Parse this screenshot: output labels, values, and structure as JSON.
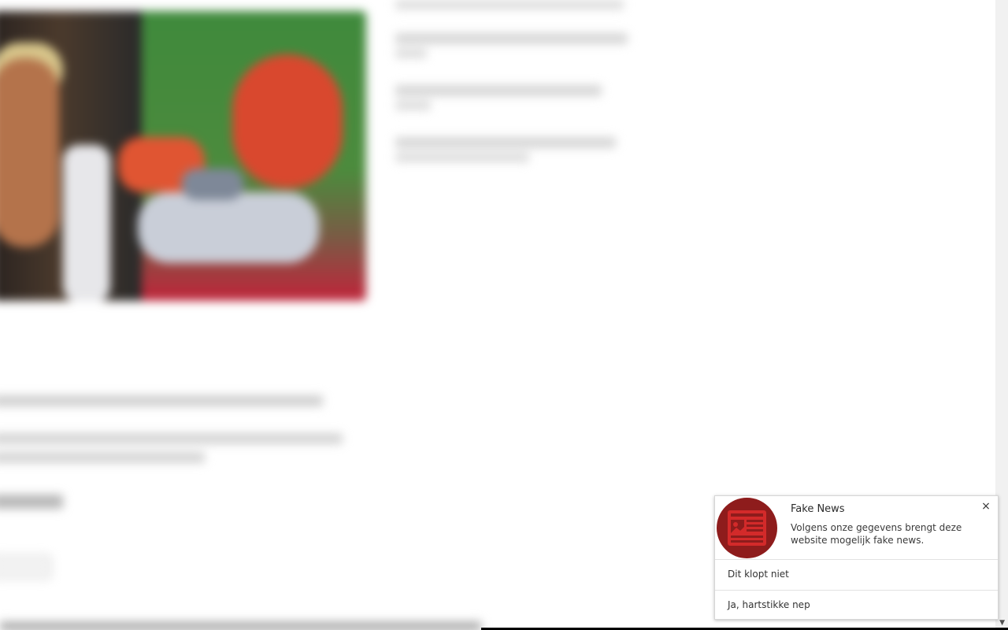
{
  "background_page": {
    "related_links": [],
    "headline": "",
    "body_lines": []
  },
  "notification": {
    "icon": "newspaper-icon",
    "icon_bg_color": "#8e1c1c",
    "title": "Fake News",
    "message": "Volgens onze gegevens brengt deze website mogelijk fake news.",
    "close_glyph": "×",
    "actions": [
      {
        "label": "Dit klopt niet"
      },
      {
        "label": "Ja, hartstikke nep"
      }
    ]
  },
  "scrollbar": {
    "down_arrow_glyph": "▼"
  }
}
